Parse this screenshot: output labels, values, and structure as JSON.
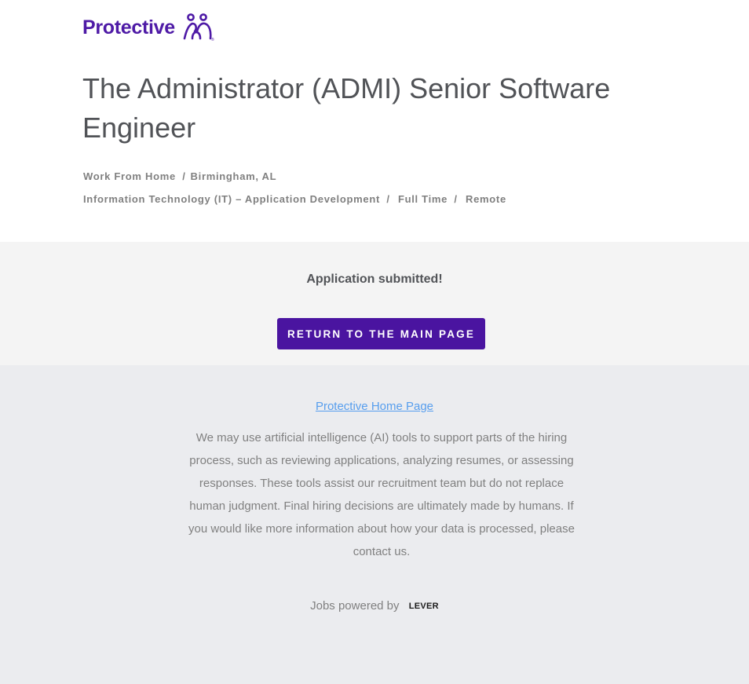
{
  "brand": {
    "name": "Protective",
    "color": "#4e1aa6"
  },
  "job": {
    "title": "The Administrator (ADMI) Senior Software Engineer",
    "location_line": {
      "location": "Work From Home",
      "city": "Birmingham, AL"
    },
    "category_line": {
      "team": "Information Technology (IT) – Application Development",
      "commitment": "Full Time",
      "workplace": "Remote"
    },
    "separator": "/"
  },
  "confirmation": {
    "message": "Application submitted!",
    "return_button": "RETURN TO THE MAIN PAGE",
    "button_color": "#4a14a0"
  },
  "footer": {
    "home_link": "Protective Home Page",
    "disclaimer": "We may use artificial intelligence (AI) tools to support parts of the hiring process, such as reviewing applications, analyzing resumes, or assessing responses. These tools assist our recruitment team but do not replace human judgment. Final hiring decisions are ultimately made by humans. If you would like more information about how your data is processed, please contact us.",
    "powered_by": "Jobs powered by",
    "powered_brand": "LEVER"
  }
}
